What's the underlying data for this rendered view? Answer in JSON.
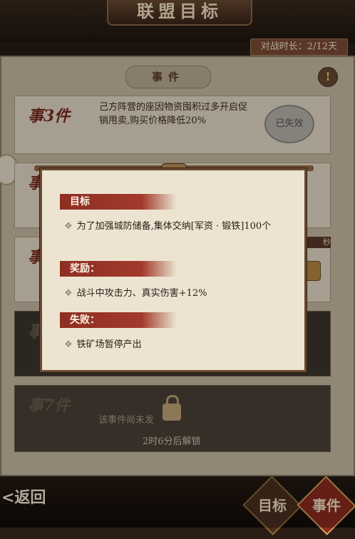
{
  "header": {
    "title": "联盟目标",
    "timer": "对战时长：2/12天"
  },
  "section_title": "事件",
  "warning_icon": "!",
  "cards": [
    {
      "badge": "事3件",
      "text": "己方阵营的座因物资囤积过多开启促销甩卖,购买价格降低20%",
      "stamp": "已失效"
    },
    {
      "badge": "事"
    },
    {
      "badge": "事"
    },
    {
      "badge": "事"
    },
    {
      "badge": "事7件",
      "locked_text": "该事件尚未发",
      "unlock_text": "2时6分后解锁"
    }
  ],
  "popup": {
    "goal_label": "目标",
    "goal_text": "为了加强城防储备,集体交纳[军资 · 锻铁]100个",
    "reward_label": "奖励：",
    "reward_text": "战斗中攻击力、真实伤害+12%",
    "fail_label": "失败：",
    "fail_text": "铁矿场暂停产出"
  },
  "side_label": "秒",
  "bottom": {
    "back": "<返回",
    "tab_goal": "目标",
    "tab_event": "事件"
  },
  "colors": {
    "accent_red": "#8e2e22",
    "panel": "#c8bba6"
  }
}
